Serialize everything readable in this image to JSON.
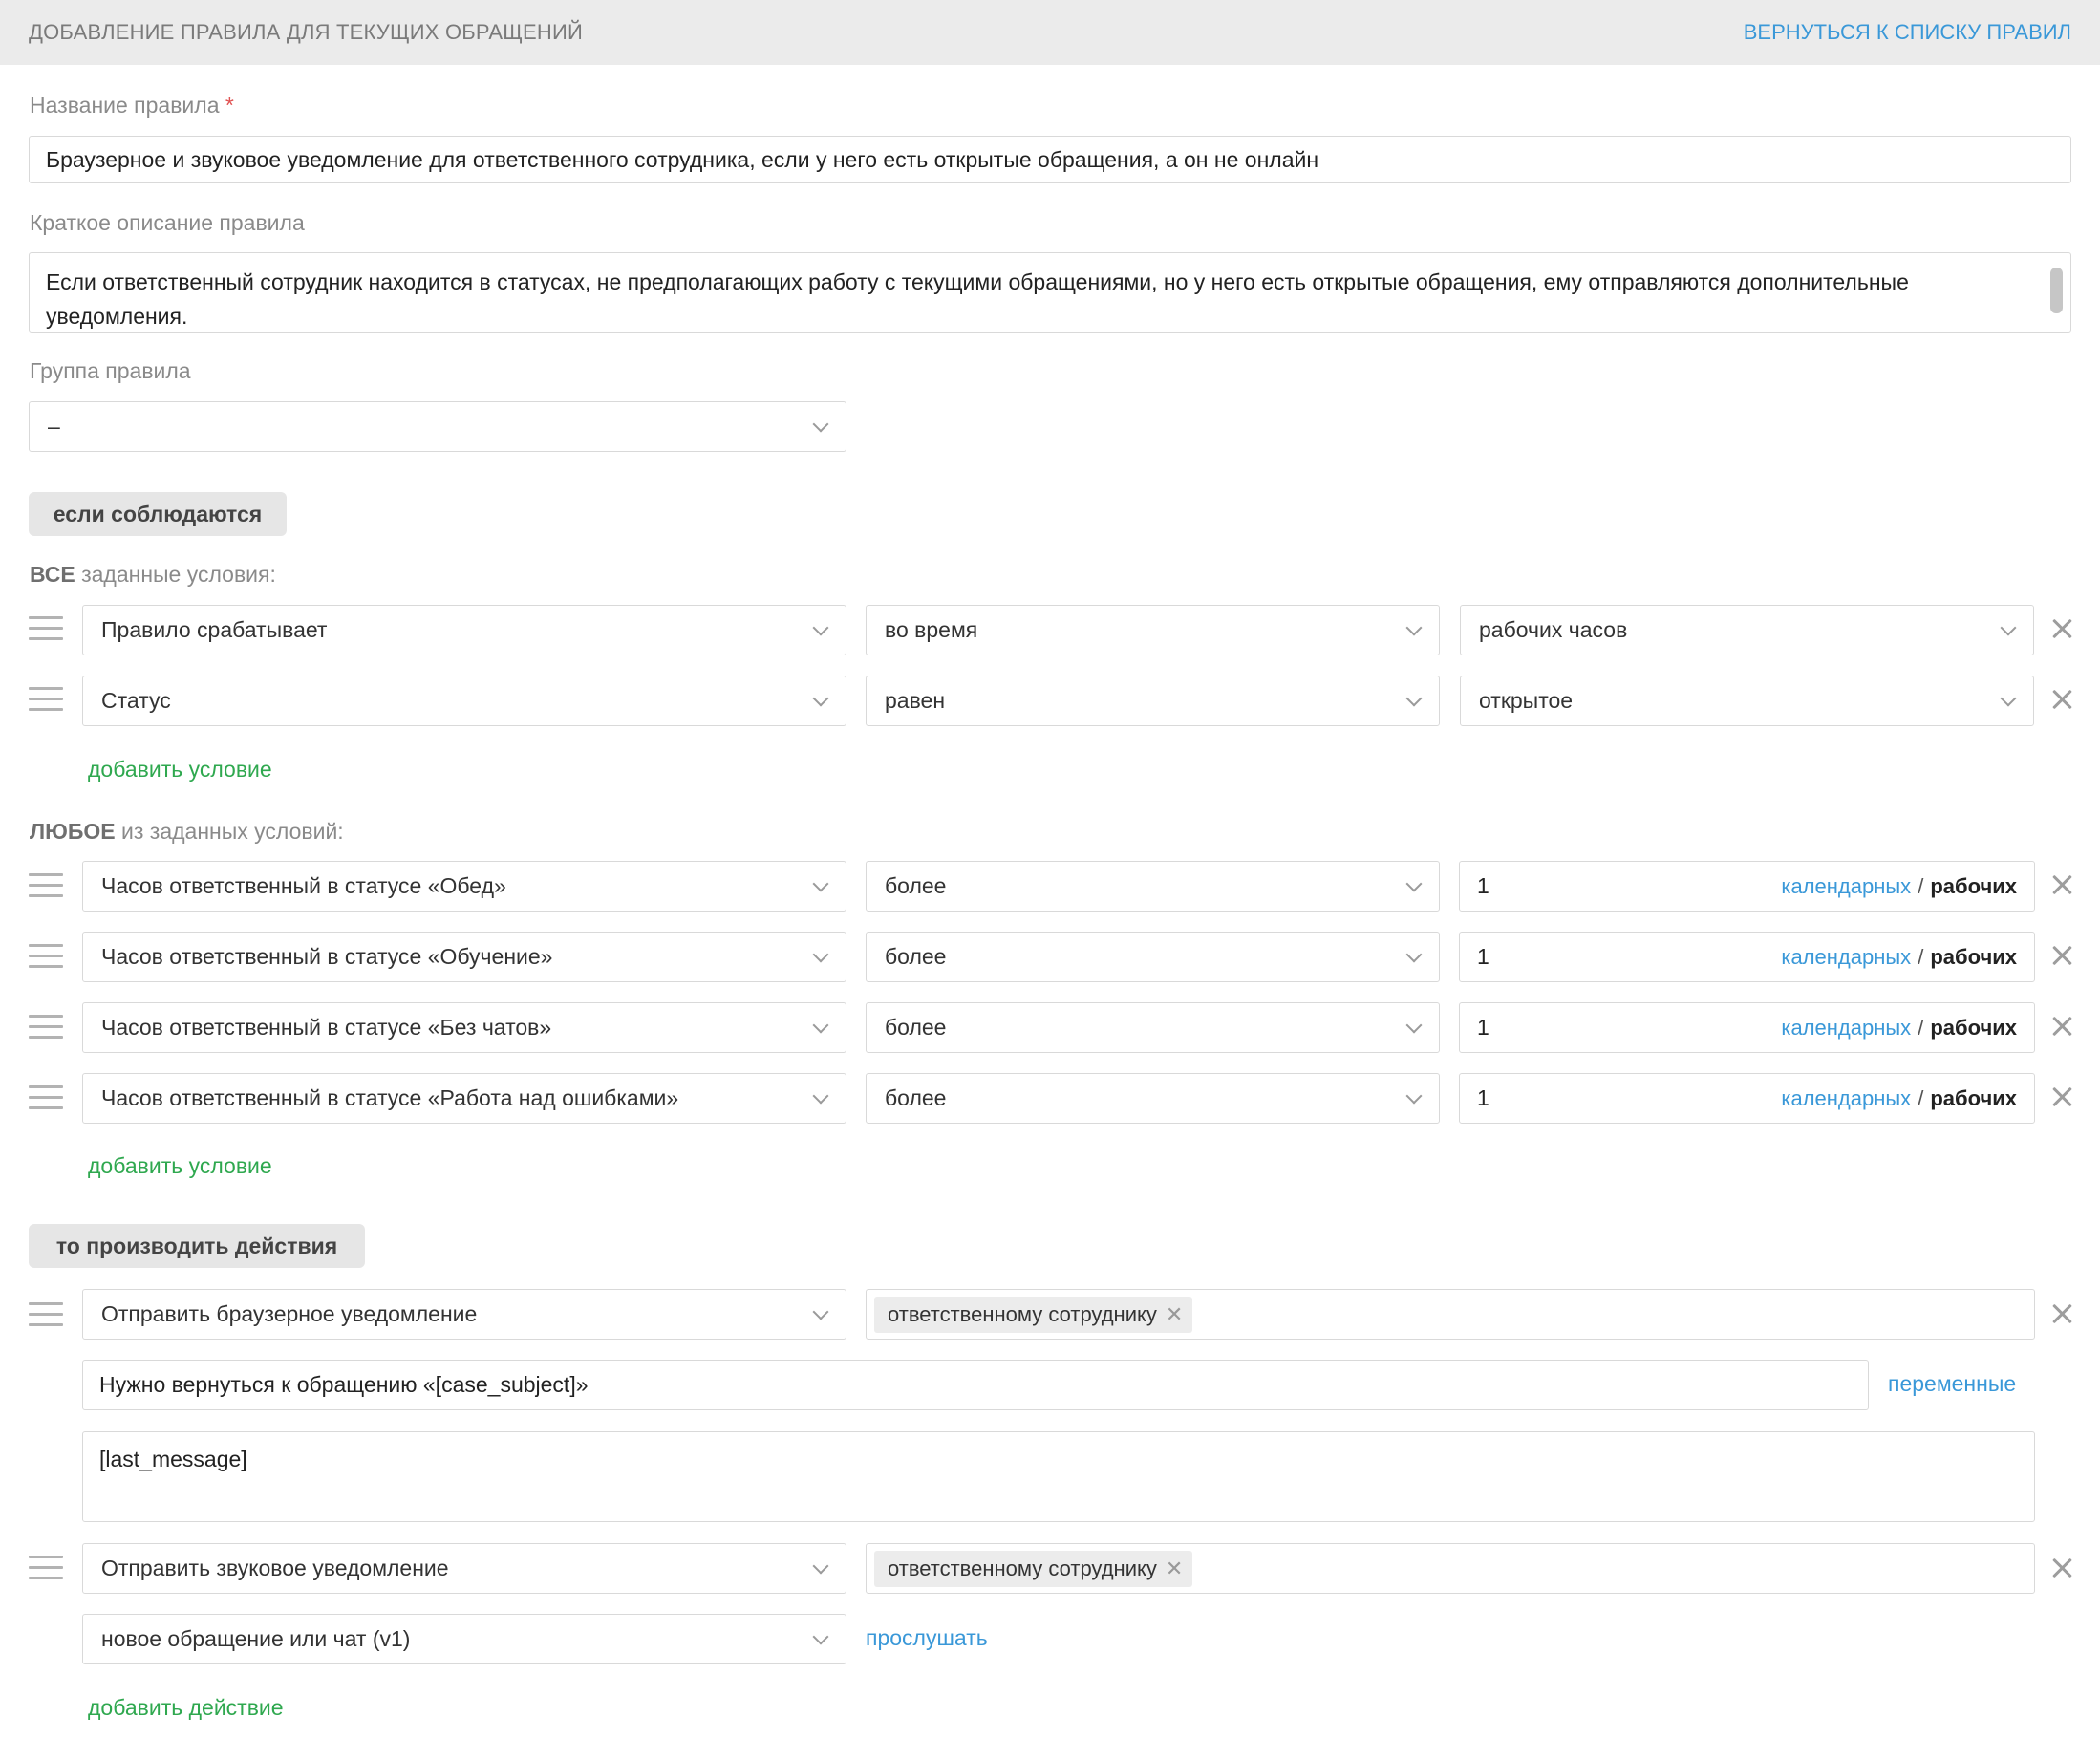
{
  "header": {
    "title": "ДОБАВЛЕНИЕ ПРАВИЛА ДЛЯ ТЕКУЩИХ ОБРАЩЕНИЙ",
    "back_link": "ВЕРНУТЬСЯ К СПИСКУ ПРАВИЛ"
  },
  "form": {
    "name_label": "Название правила",
    "required_mark": "*",
    "name_value": "Браузерное и звуковое уведомление для ответственного сотрудника, если у него есть открытые обращения, а он не онлайн",
    "desc_label": "Краткое описание правила",
    "desc_value": "Если ответственный сотрудник находится в статусах, не предполагающих работу с текущими обращениями, но у него есть открытые обращения, ему отправляются дополнительные уведомления.",
    "group_label": "Группа правила",
    "group_value": "–"
  },
  "conditions": {
    "section_label": "если соблюдаются",
    "all_head_bold": "ВСЕ",
    "all_head_rest": " заданные условия:",
    "all_rows": [
      {
        "field": "Правило срабатывает",
        "op": "во время",
        "value": "рабочих часов"
      },
      {
        "field": "Статус",
        "op": "равен",
        "value": "открытое"
      }
    ],
    "add_condition": "добавить условие",
    "any_head_bold": "ЛЮБОЕ",
    "any_head_rest": " из заданных условий:",
    "any_rows": [
      {
        "field": "Часов ответственный в статусе «Обед»",
        "op": "более",
        "value": "1"
      },
      {
        "field": "Часов ответственный в статусе «Обучение»",
        "op": "более",
        "value": "1"
      },
      {
        "field": "Часов ответственный в статусе «Без чатов»",
        "op": "более",
        "value": "1"
      },
      {
        "field": "Часов ответственный в статусе «Работа над ошибками»",
        "op": "более",
        "value": "1"
      }
    ],
    "unit_calendar": "календарных",
    "unit_sep": "/",
    "unit_working": "рабочих"
  },
  "actions": {
    "section_label": "то производить действия",
    "browser": {
      "type": "Отправить браузерное уведомление",
      "recipient": "ответственному сотруднику",
      "subject": "Нужно вернуться к обращению «[case_subject]»",
      "variables_link": "переменные",
      "body": "[last_message]"
    },
    "sound": {
      "type": "Отправить звуковое уведомление",
      "recipient": "ответственному сотруднику",
      "sound": "новое обращение или чат (v1)",
      "listen_link": "прослушать"
    },
    "add_action": "добавить действие"
  }
}
